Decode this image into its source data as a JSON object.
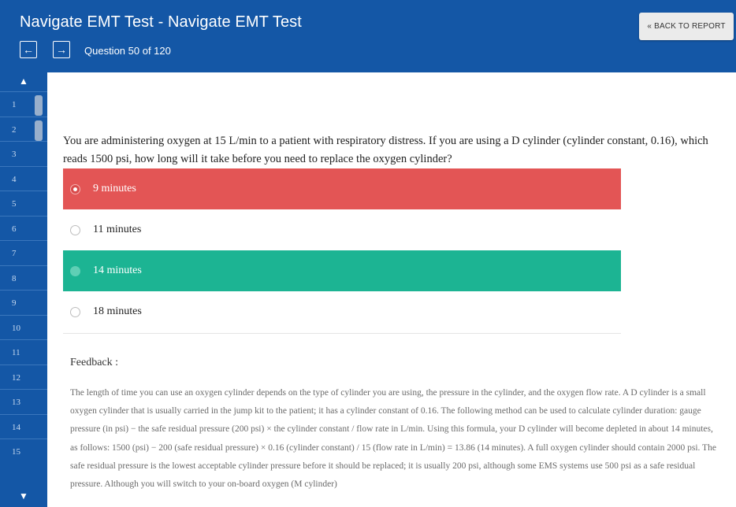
{
  "header": {
    "title": "Navigate EMT Test - Navigate EMT Test",
    "prev_icon": "←",
    "next_icon": "→",
    "question_counter": "Question 50 of 120",
    "back_label": "« BACK TO REPORT"
  },
  "sidebar": {
    "up_icon": "▲",
    "down_icon": "▼",
    "questions": [
      "1",
      "2",
      "3",
      "4",
      "5",
      "6",
      "7",
      "8",
      "9",
      "10",
      "11",
      "12",
      "13",
      "14",
      "15"
    ],
    "marked": [
      "1",
      "2"
    ]
  },
  "question": {
    "text": "You are administering oxygen at 15 L/min to a patient with respiratory distress. If you are using a D cylinder (cylinder constant, 0.16), which reads 1500 psi, how long will it take before you need to replace the oxygen cylinder?",
    "answers": [
      {
        "label": "9 minutes",
        "state": "wrong"
      },
      {
        "label": "11 minutes",
        "state": "none"
      },
      {
        "label": "14 minutes",
        "state": "correct"
      },
      {
        "label": "18 minutes",
        "state": "none"
      }
    ]
  },
  "feedback": {
    "label": "Feedback :",
    "text": "The length of time you can use an oxygen cylinder depends on the type of cylinder you are using, the pressure in the cylinder, and the oxygen flow rate. A D cylinder is a small oxygen cylinder that is usually carried in the jump kit to the patient; it has a cylinder constant of 0.16. The following method can be used to calculate cylinder duration: gauge pressure (in psi) − the safe residual pressure (200 psi) × the cylinder constant / flow rate in L/min. Using this formula, your D cylinder will become depleted in about 14 minutes, as follows: 1500 (psi) − 200 (safe residual pressure) × 0.16 (cylinder constant) / 15 (flow rate in L/min) = 13.86 (14 minutes). A full oxygen cylinder should contain 2000 psi. The safe residual pressure is the lowest acceptable cylinder pressure before it should be replaced; it is usually 200 psi, although some EMS systems use 500 psi as a safe residual pressure. Although you will switch to your on-board oxygen (M cylinder)"
  },
  "colors": {
    "brand_blue": "#1457a6",
    "wrong_red": "#e35555",
    "correct_green": "#1cb493"
  }
}
